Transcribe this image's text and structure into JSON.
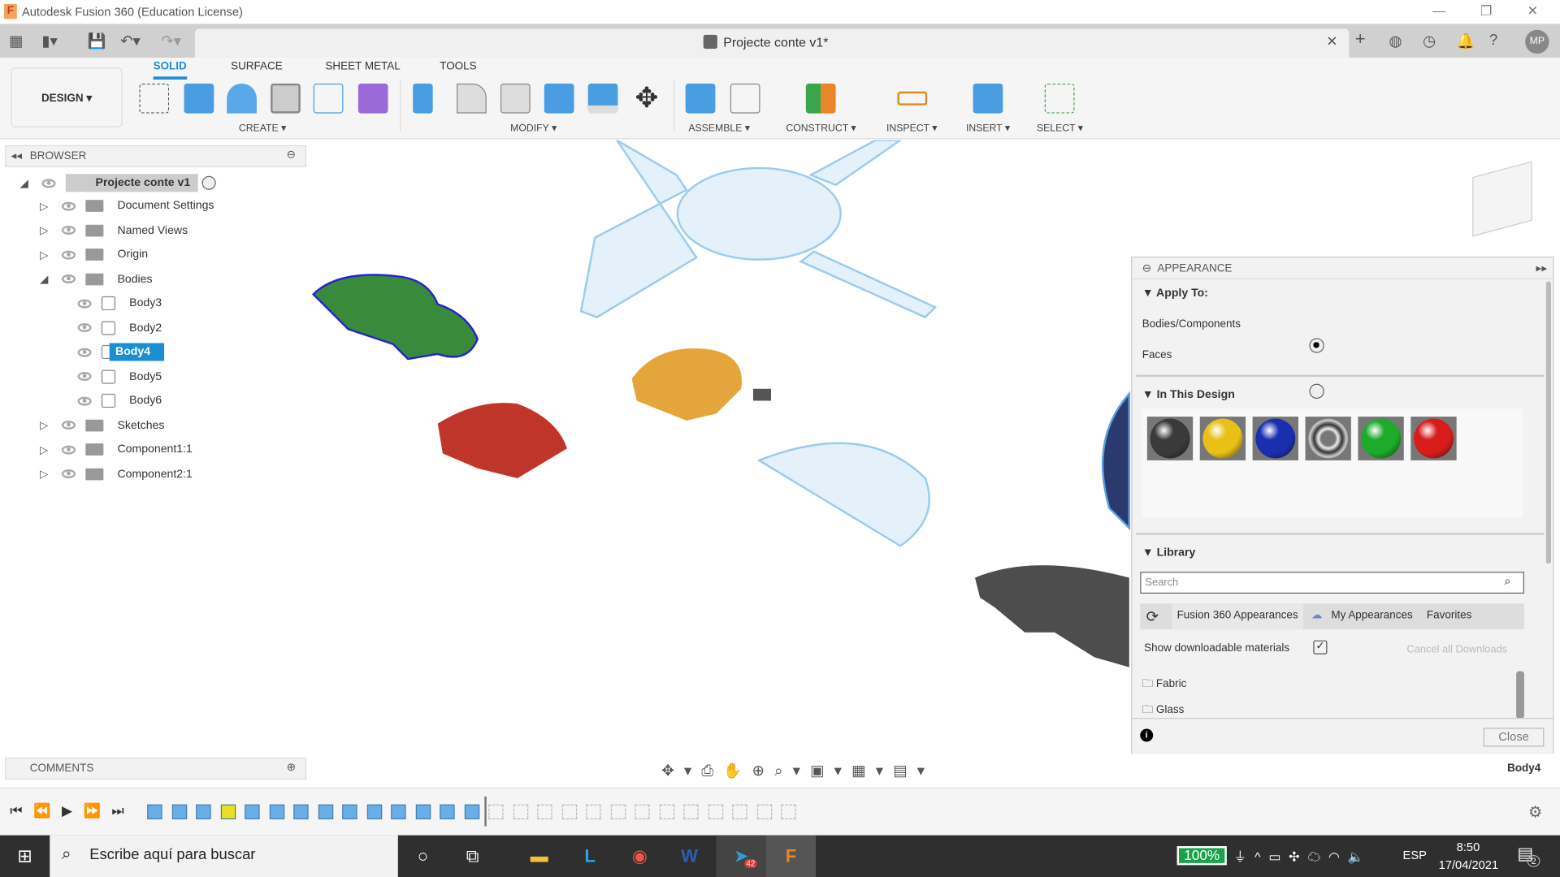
{
  "app": {
    "title": "Autodesk Fusion 360 (Education License)",
    "doc_title": "Projecte conte v1*",
    "user_initials": "MP"
  },
  "ribbon": {
    "workspace": "DESIGN ▾",
    "tabs": [
      "SOLID",
      "SURFACE",
      "SHEET METAL",
      "TOOLS"
    ],
    "active_tab": "SOLID",
    "groups": [
      "CREATE ▾",
      "MODIFY ▾",
      "ASSEMBLE ▾",
      "CONSTRUCT ▾",
      "INSPECT ▾",
      "INSERT ▾",
      "SELECT ▾"
    ]
  },
  "browser": {
    "title": "BROWSER",
    "root": "Projecte conte v1",
    "items": [
      {
        "label": "Document Settings",
        "level": 1
      },
      {
        "label": "Named Views",
        "level": 1
      },
      {
        "label": "Origin",
        "level": 1
      },
      {
        "label": "Bodies",
        "level": 1,
        "expanded": true
      },
      {
        "label": "Body3",
        "level": 2
      },
      {
        "label": "Body2",
        "level": 2
      },
      {
        "label": "Body4",
        "level": 2,
        "selected": true
      },
      {
        "label": "Body5",
        "level": 2
      },
      {
        "label": "Body6",
        "level": 2
      },
      {
        "label": "Sketches",
        "level": 1
      },
      {
        "label": "Component1:1",
        "level": 1
      },
      {
        "label": "Component2:1",
        "level": 1
      }
    ]
  },
  "comments": {
    "title": "COMMENTS"
  },
  "appearance": {
    "title": "APPEARANCE",
    "apply_to": "Apply To:",
    "options": [
      {
        "label": "Bodies/Components",
        "selected": true
      },
      {
        "label": "Faces",
        "selected": false
      }
    ],
    "in_design": "In This Design",
    "swatches": [
      "#3a3a3a",
      "#e8c018",
      "#1a2fb0",
      "chrome",
      "#1eaa2a",
      "#d81c1c"
    ],
    "library": "Library",
    "search_placeholder": "Search",
    "lib_tabs": [
      "Fusion 360 Appearances",
      "My Appearances",
      "Favorites"
    ],
    "show_downloadable": "Show downloadable materials",
    "show_downloadable_checked": true,
    "cancel_downloads": "Cancel all Downloads",
    "folders": [
      "Fabric",
      "Glass"
    ],
    "close": "Close"
  },
  "status": {
    "selection": "Body4"
  },
  "taskbar": {
    "search_placeholder": "Escribe aquí para buscar",
    "battery": "100%",
    "language": "ESP",
    "time": "8:50",
    "date": "17/04/2021",
    "notifications": "2",
    "telegram_badge": "42"
  }
}
